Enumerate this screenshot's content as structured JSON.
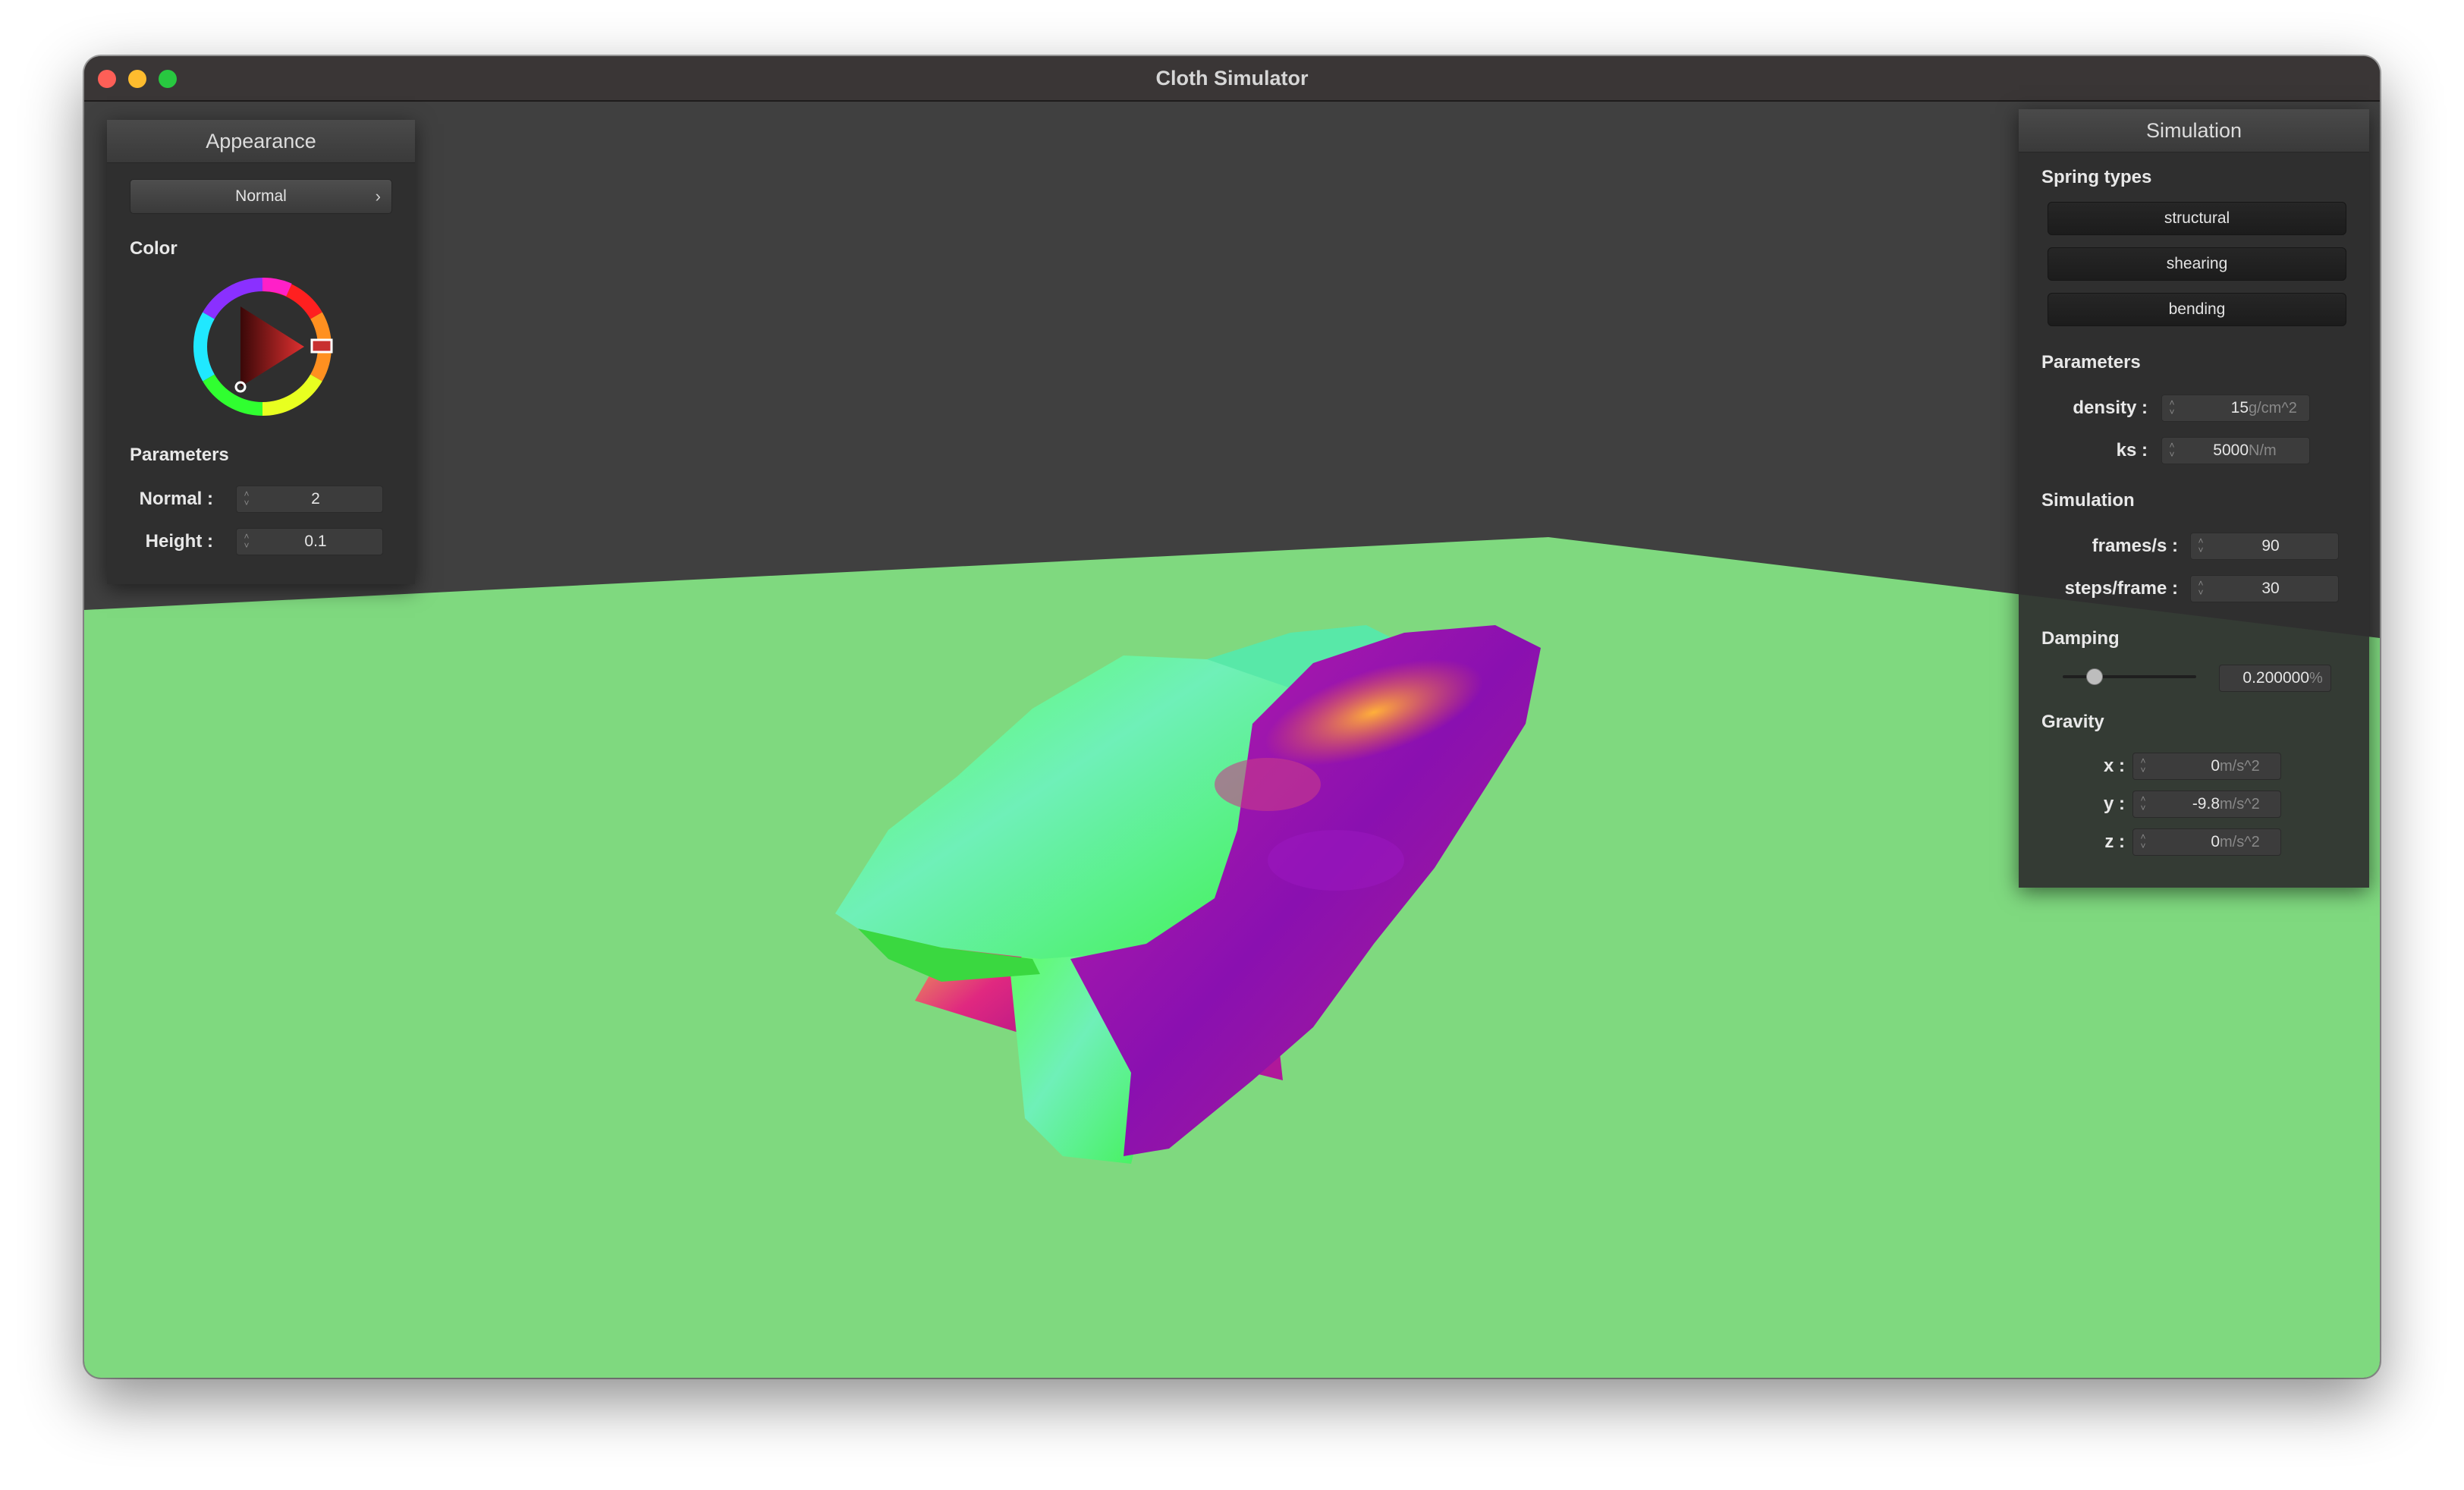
{
  "window": {
    "title": "Cloth Simulator"
  },
  "appearance": {
    "header": "Appearance",
    "shader_dropdown": {
      "selected": "Normal",
      "chevron": "›"
    },
    "color_label": "Color",
    "parameters_label": "Parameters",
    "normal": {
      "label": "Normal :",
      "value": "2"
    },
    "height": {
      "label": "Height :",
      "value": "0.1"
    },
    "colors": {
      "picked": "#c83030"
    }
  },
  "simulation": {
    "header": "Simulation",
    "spring_types_label": "Spring types",
    "spring_buttons": [
      "structural",
      "shearing",
      "bending"
    ],
    "parameters_label": "Parameters",
    "density": {
      "label": "density :",
      "value": "15",
      "unit": "g/cm^2"
    },
    "ks": {
      "label": "ks :",
      "value": "5000",
      "unit": "N/m"
    },
    "simulation_label": "Simulation",
    "frames_per_s": {
      "label": "frames/s :",
      "value": "90"
    },
    "steps_per_frame": {
      "label": "steps/frame :",
      "value": "30"
    },
    "damping_label": "Damping",
    "damping": {
      "value": "0.200000",
      "unit": "%",
      "slider_fraction": 0.2
    },
    "gravity_label": "Gravity",
    "gravity": [
      {
        "label": "x :",
        "value": "0",
        "unit": "m/s^2"
      },
      {
        "label": "y :",
        "value": "-9.8",
        "unit": "m/s^2"
      },
      {
        "label": "z :",
        "value": "0",
        "unit": "m/s^2"
      }
    ]
  },
  "scene": {
    "background_color": "#404040",
    "floor_color": "#7fd97f"
  }
}
